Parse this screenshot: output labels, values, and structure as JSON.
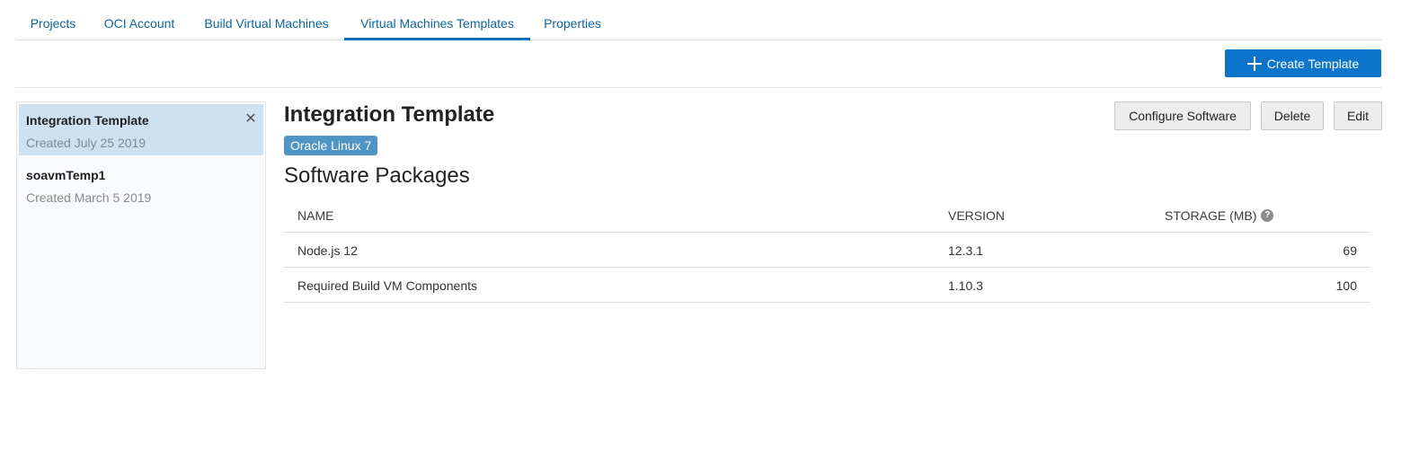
{
  "tabs": [
    {
      "label": "Projects"
    },
    {
      "label": "OCI Account"
    },
    {
      "label": "Build Virtual Machines"
    },
    {
      "label": "Virtual Machines Templates",
      "active": true
    },
    {
      "label": "Properties"
    }
  ],
  "toolbar": {
    "create_label": "Create Template",
    "create_icon": "plus-icon"
  },
  "templates": [
    {
      "name": "Integration Template",
      "created": "Created July 25 2019",
      "selected": true
    },
    {
      "name": "soavmTemp1",
      "created": "Created March 5 2019",
      "selected": false
    }
  ],
  "detail": {
    "title": "Integration Template",
    "os_badge": "Oracle Linux 7",
    "section_title": "Software Packages",
    "buttons": {
      "configure": "Configure Software",
      "delete": "Delete",
      "edit": "Edit"
    },
    "table": {
      "columns": {
        "name": "NAME",
        "version": "VERSION",
        "storage": "STORAGE (MB)"
      },
      "rows": [
        {
          "name": "Node.js 12",
          "version": "12.3.1",
          "storage": "69"
        },
        {
          "name": "Required Build VM Components",
          "version": "1.10.3",
          "storage": "100"
        }
      ]
    }
  },
  "colors": {
    "accent": "#0b75cc",
    "tab_link": "#0b66a8",
    "badge": "#4f95c5",
    "selected_row": "#cde1f0"
  }
}
